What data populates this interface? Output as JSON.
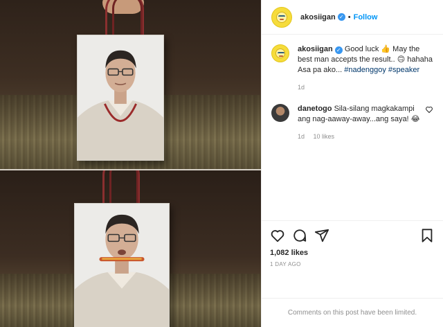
{
  "post": {
    "username": "akosiigan",
    "follow_label": "Follow",
    "separator": "•"
  },
  "caption": {
    "username": "akosiigan",
    "text_before_emoji": "Good luck",
    "thumbs_emoji": "👍",
    "text_after_emoji": "May the best man accepts the result..",
    "smile_emoji": "🙃",
    "text_tail": "hahaha Asa pa ako...",
    "hashtags": [
      "#nadenggoy",
      "#speaker"
    ],
    "time": "1d"
  },
  "reply": {
    "username": "danetogo",
    "text": "Sila-silang magkakampi ang nag-aaway-away...ang saya!",
    "emoji": "😂",
    "time": "1d",
    "likes": "10 likes"
  },
  "actions": {
    "likes_count": "1,082 likes",
    "timestamp": "1 DAY AGO"
  },
  "footer": {
    "limited_text": "Comments on this post have been limited."
  },
  "colors": {
    "link": "#0095f6",
    "hashtag": "#00376b",
    "muted": "#8e8e8e",
    "verified": "#3897f0"
  },
  "icons": [
    "heart-icon",
    "comment-icon",
    "share-icon",
    "bookmark-icon",
    "verified-badge-icon"
  ]
}
